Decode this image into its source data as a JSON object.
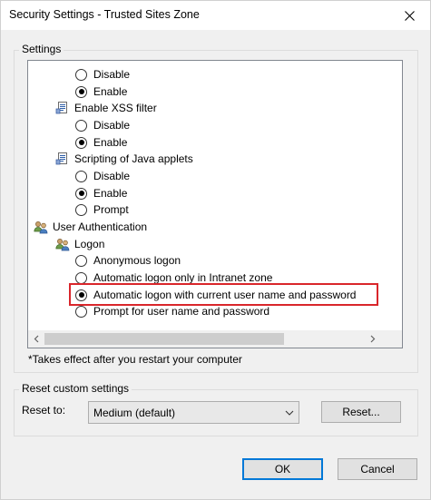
{
  "window": {
    "title": "Security Settings - Trusted Sites Zone"
  },
  "settings_group": {
    "label": "Settings"
  },
  "tree": {
    "rows": [
      {
        "type": "radio",
        "label": "Disable",
        "checked": false
      },
      {
        "type": "radio",
        "label": "Enable",
        "checked": true
      },
      {
        "type": "category",
        "label": "Enable XSS filter",
        "icon": "settings-page-icon"
      },
      {
        "type": "radio",
        "label": "Disable",
        "checked": false
      },
      {
        "type": "radio",
        "label": "Enable",
        "checked": true
      },
      {
        "type": "category",
        "label": "Scripting of Java applets",
        "icon": "settings-page-icon"
      },
      {
        "type": "radio",
        "label": "Disable",
        "checked": false
      },
      {
        "type": "radio",
        "label": "Enable",
        "checked": true
      },
      {
        "type": "radio",
        "label": "Prompt",
        "checked": false
      },
      {
        "type": "category",
        "label": "User Authentication",
        "icon": "users-icon"
      },
      {
        "type": "subcategory",
        "label": "Logon",
        "icon": "users-icon"
      },
      {
        "type": "radio",
        "label": "Anonymous logon",
        "checked": false
      },
      {
        "type": "radio",
        "label": "Automatic logon only in Intranet zone",
        "checked": false
      },
      {
        "type": "radio",
        "label": "Automatic logon with current user name and password",
        "checked": true,
        "highlighted": true
      },
      {
        "type": "radio",
        "label": "Prompt for user name and password",
        "checked": false
      }
    ]
  },
  "note": "*Takes effect after you restart your computer",
  "reset_group": {
    "label": "Reset custom settings",
    "reset_to_label": "Reset to:",
    "selected_level": "Medium (default)",
    "reset_button": "Reset..."
  },
  "buttons": {
    "ok": "OK",
    "cancel": "Cancel"
  },
  "colors": {
    "highlight_border": "#d9262b",
    "default_button_border": "#0078d7"
  }
}
